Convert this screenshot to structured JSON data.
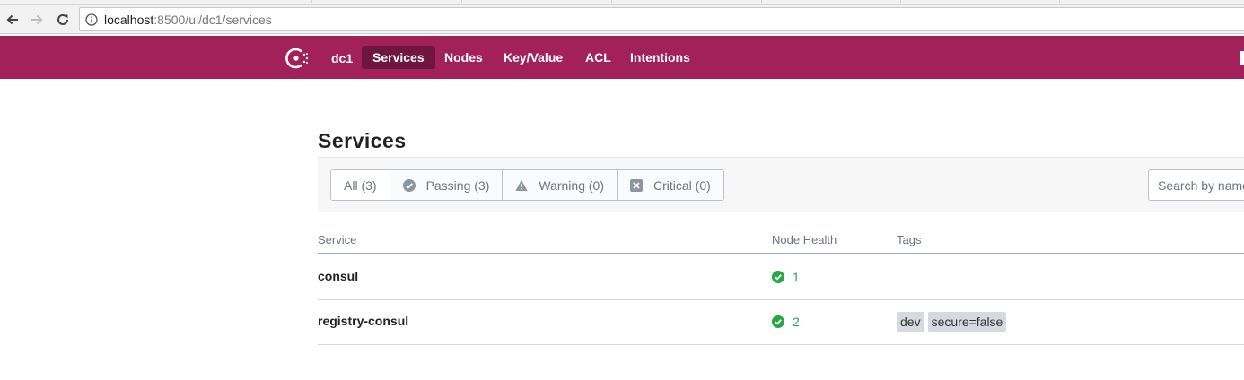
{
  "browser": {
    "url_host": "localhost",
    "url_rest": ":8500/ui/dc1/services"
  },
  "header": {
    "datacenter": "dc1",
    "nav": [
      {
        "label": "Services",
        "active": true
      },
      {
        "label": "Nodes",
        "active": false
      },
      {
        "label": "Key/Value",
        "active": false
      },
      {
        "label": "ACL",
        "active": false
      },
      {
        "label": "Intentions",
        "active": false
      }
    ],
    "brand_color": "#a2215b",
    "active_color": "#6f1640"
  },
  "page": {
    "title": "Services",
    "filters": [
      {
        "label": "All (3)",
        "icon": ""
      },
      {
        "label": "Passing (3)",
        "icon": "check-circle-icon"
      },
      {
        "label": "Warning (0)",
        "icon": "warning-triangle-icon"
      },
      {
        "label": "Critical (0)",
        "icon": "critical-x-icon"
      }
    ],
    "search_placeholder": "Search by name"
  },
  "table": {
    "columns": [
      "Service",
      "Node Health",
      "Tags"
    ],
    "rows": [
      {
        "service": "consul",
        "health": "1",
        "tags": []
      },
      {
        "service": "registry-consul",
        "health": "2",
        "tags": [
          "dev",
          "secure=false"
        ]
      }
    ]
  },
  "colors": {
    "passing": "#28a745"
  }
}
